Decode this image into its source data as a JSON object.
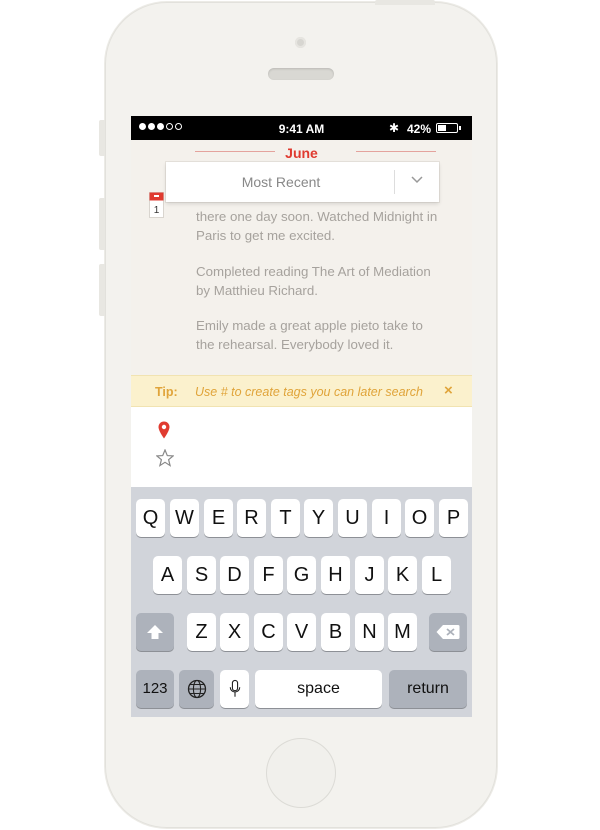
{
  "status_bar": {
    "time": "9:41 AM",
    "battery": "42%",
    "bluetooth_glyph": "✱"
  },
  "timeline": {
    "month": "June",
    "sort_dropdown": "Most Recent",
    "calendar_day": "1",
    "entries": [
      {
        "lines": [
          "there one day soon. Watched Midnight in",
          "Paris to get me excited."
        ]
      },
      {
        "lines": [
          "Completed reading The Art of Mediation",
          "by Matthieu Richard."
        ]
      },
      {
        "lines": [
          "Emily made a great apple pieto take to",
          "the rehearsal. Everybody loved it."
        ]
      }
    ]
  },
  "tip": {
    "label": "Tip:",
    "text": "Use # to create tags you can later search",
    "close": "×"
  },
  "compose": {
    "icons": [
      "location-pin-icon",
      "star-icon"
    ]
  },
  "keyboard": {
    "row1": [
      "Q",
      "W",
      "E",
      "R",
      "T",
      "Y",
      "U",
      "I",
      "O",
      "P"
    ],
    "row2": [
      "A",
      "S",
      "D",
      "F",
      "G",
      "H",
      "J",
      "K",
      "L"
    ],
    "row3": [
      "Z",
      "X",
      "C",
      "V",
      "B",
      "N",
      "M"
    ],
    "numbers": "123",
    "space": "space",
    "return": "return"
  },
  "colors": {
    "accent_red": "#e03b30",
    "tip_text": "#e0a43a",
    "tip_bg": "#fbf1cd"
  }
}
